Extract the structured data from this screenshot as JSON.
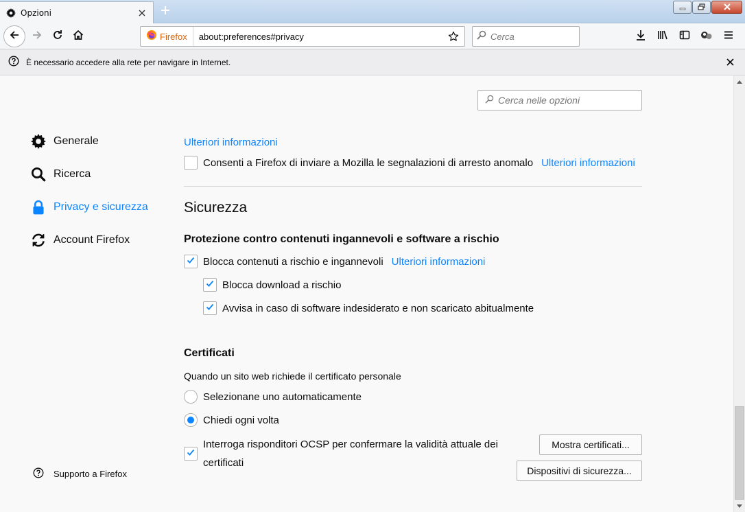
{
  "tab": {
    "title": "Opzioni",
    "icon": "gear-icon",
    "close_icon": "close-icon"
  },
  "newtab_icon": "plus-icon",
  "window_controls": [
    "minimize-icon",
    "maximize-icon",
    "close-icon"
  ],
  "nav": {
    "back_icon": "arrow-left-icon",
    "forward_icon": "arrow-right-icon",
    "reload_icon": "reload-icon",
    "home_icon": "home-icon",
    "identity_label": "Firefox",
    "url": "about:preferences#privacy",
    "search_placeholder": "Cerca",
    "right_icons": [
      "download-icon",
      "library-icon",
      "sidebar-icon",
      "extension-icon",
      "hamburger-menu-icon"
    ]
  },
  "notification": {
    "message": "È necessario accedere alla rete per navigare in Internet.",
    "icon": "help-icon"
  },
  "prefs": {
    "search_placeholder": "Cerca nelle opzioni",
    "categories": [
      {
        "label": "Generale",
        "icon": "gear-icon",
        "selected": false
      },
      {
        "label": "Ricerca",
        "icon": "search-icon",
        "selected": false
      },
      {
        "label": "Privacy e sicurezza",
        "icon": "lock-icon",
        "selected": true
      },
      {
        "label": "Account Firefox",
        "icon": "sync-icon",
        "selected": false
      }
    ],
    "support_label": "Supporto a Firefox",
    "learn_more_top": "Ulteriori informazioni",
    "crash_reports": {
      "label": "Consenti a Firefox di inviare a Mozilla le segnalazioni di arresto anomalo",
      "link": "Ulteriori informazioni",
      "checked": false
    },
    "security_heading": "Sicurezza",
    "deceptive": {
      "heading": "Protezione contro contenuti ingannevoli e software a rischio",
      "block_dangerous": {
        "label": "Blocca contenuti a rischio e ingannevoli",
        "link": "Ulteriori informazioni",
        "checked": true
      },
      "block_downloads": {
        "label": "Blocca download a rischio",
        "checked": true
      },
      "warn_unwanted": {
        "label": "Avvisa in caso di software indesiderato e non scaricato abitualmente",
        "checked": true
      }
    },
    "certificates": {
      "heading": "Certificati",
      "description": "Quando un sito web richiede il certificato personale",
      "radio_auto": {
        "label": "Selezionane uno automaticamente",
        "selected": false
      },
      "radio_ask": {
        "label": "Chiedi ogni volta",
        "selected": true
      },
      "ocsp": {
        "label": "Interroga risponditori OCSP per confermare la validità attuale dei certificati",
        "checked": true
      },
      "view_button": "Mostra certificati...",
      "devices_button": "Dispositivi di sicurezza..."
    }
  },
  "colors": {
    "accent": "#0a84ff",
    "identity": "#d7640e",
    "background": "#f9f9fa"
  }
}
